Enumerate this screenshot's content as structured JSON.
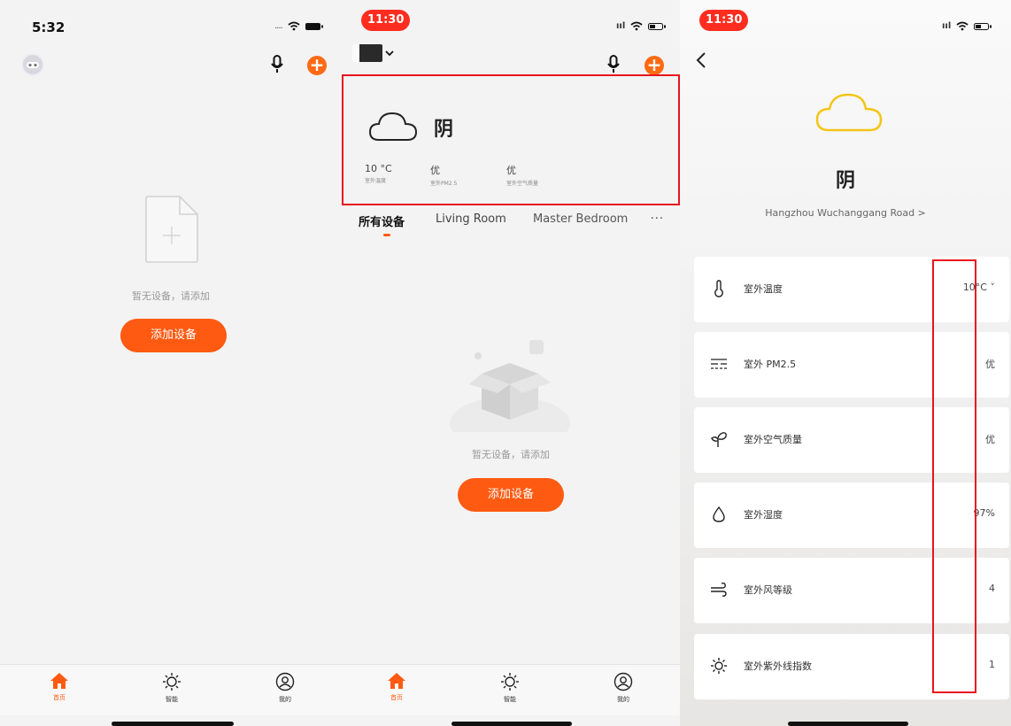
{
  "screen1": {
    "time": "5:32",
    "empty_text": "暂无设备，请添加",
    "add_button": "添加设备",
    "nav": [
      {
        "icon": "home-icon",
        "label": "首页"
      },
      {
        "icon": "sun-icon",
        "label": "智能"
      },
      {
        "icon": "user-icon",
        "label": "我的"
      }
    ]
  },
  "screen2": {
    "time": "11:30",
    "weather": {
      "icon": "cloud-icon",
      "condition": "阴",
      "metrics": [
        {
          "value": "10 °C",
          "label": "室外温度"
        },
        {
          "value": "优",
          "label": "室外PM2.5"
        },
        {
          "value": "优",
          "label": "室外空气质量"
        }
      ]
    },
    "rooms": [
      "所有设备",
      "Living Room",
      "Master Bedroom"
    ],
    "more": "···",
    "empty_text": "暂无设备，请添加",
    "add_button": "添加设备",
    "nav": [
      {
        "icon": "home-icon",
        "label": "首页"
      },
      {
        "icon": "sun-icon",
        "label": "智能"
      },
      {
        "icon": "user-icon",
        "label": "我的"
      }
    ]
  },
  "screen3": {
    "time": "11:30",
    "condition": "阴",
    "location": "Hangzhou Wuchanggang Road >",
    "rows": [
      {
        "icon": "thermometer-icon",
        "name": "室外温度",
        "value": "10°C ˅"
      },
      {
        "icon": "pm25-icon",
        "name": "室外 PM2.5",
        "value": "优"
      },
      {
        "icon": "sprout-icon",
        "name": "室外空气质量",
        "value": "优"
      },
      {
        "icon": "droplet-icon",
        "name": "室外湿度",
        "value": "97%"
      },
      {
        "icon": "wind-icon",
        "name": "室外风等级",
        "value": "4"
      },
      {
        "icon": "sun-icon",
        "name": "室外紫外线指数",
        "value": "1"
      }
    ]
  },
  "colors": {
    "accent": "#ff5a12",
    "highlight": "#e8141e",
    "cloud_yellow": "#f5c518",
    "time_pill": "#ff2d1f"
  }
}
